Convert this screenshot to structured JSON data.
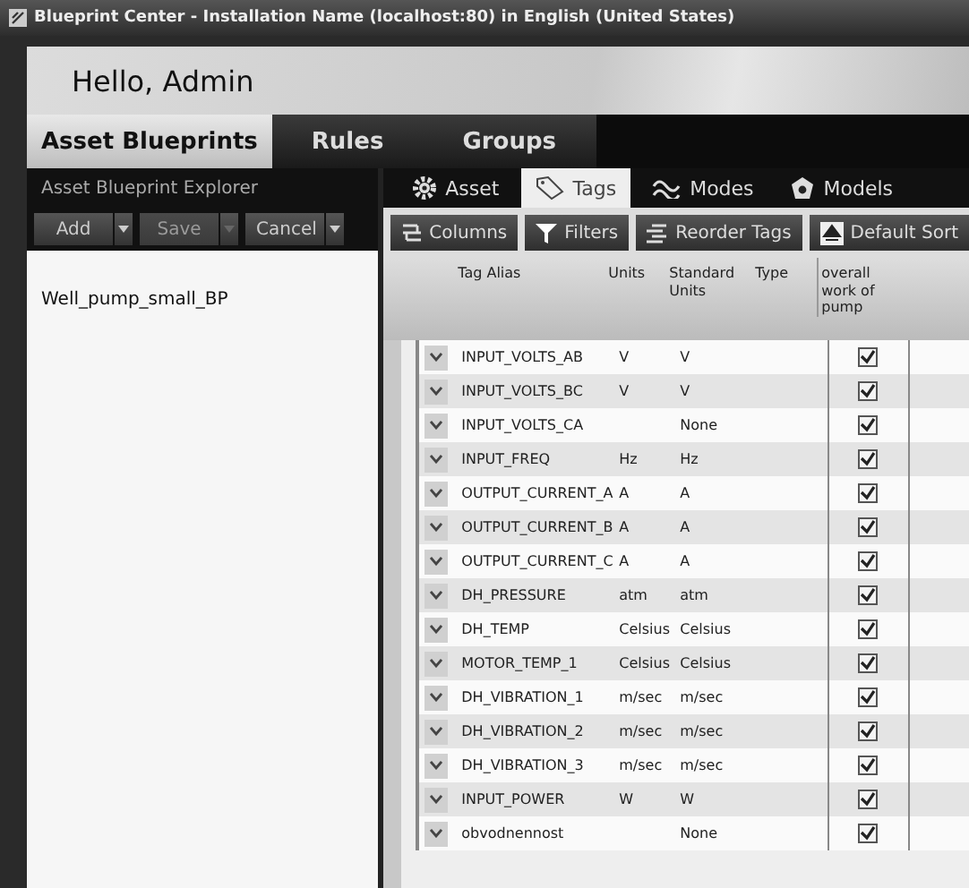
{
  "window": {
    "title": "Blueprint Center - Installation Name (localhost:80) in English (United States)"
  },
  "greeting": "Hello, Admin",
  "main_tabs": [
    {
      "label": "Asset Blueprints",
      "selected": true
    },
    {
      "label": "Rules",
      "selected": false
    },
    {
      "label": "Groups",
      "selected": false
    }
  ],
  "explorer": {
    "title": "Asset Blueprint Explorer",
    "buttons": [
      {
        "label": "Add",
        "disabled": false
      },
      {
        "label": "Save",
        "disabled": true
      },
      {
        "label": "Cancel",
        "disabled": false
      }
    ],
    "items": [
      {
        "label": "Well_pump_small_BP",
        "selected": false
      }
    ]
  },
  "detail_tabs": [
    {
      "label": "Asset",
      "selected": false
    },
    {
      "label": "Tags",
      "selected": true
    },
    {
      "label": "Modes",
      "selected": false
    },
    {
      "label": "Models",
      "selected": false
    }
  ],
  "toolbar": [
    {
      "label": "Columns"
    },
    {
      "label": "Filters"
    },
    {
      "label": "Reorder Tags"
    },
    {
      "label": "Default Sort"
    }
  ],
  "table": {
    "columns": [
      "Tag Alias",
      "Units",
      "Standard Units",
      "Type",
      "overall work of pump"
    ],
    "rows": [
      {
        "alias": "INPUT_VOLTS_AB",
        "units": "V",
        "standard_units": "V",
        "checked": true
      },
      {
        "alias": "INPUT_VOLTS_BC",
        "units": "V",
        "standard_units": "V",
        "checked": true
      },
      {
        "alias": "INPUT_VOLTS_CA",
        "standard_units": "None",
        "checked": true
      },
      {
        "alias": "INPUT_FREQ",
        "units": "Hz",
        "standard_units": "Hz",
        "checked": true
      },
      {
        "alias": "OUTPUT_CURRENT_A",
        "units": "A",
        "standard_units": "A",
        "checked": true
      },
      {
        "alias": "OUTPUT_CURRENT_B",
        "units": "A",
        "standard_units": "A",
        "checked": true
      },
      {
        "alias": "OUTPUT_CURRENT_C",
        "units": "A",
        "standard_units": "A",
        "checked": true
      },
      {
        "alias": "DH_PRESSURE",
        "units": "atm",
        "standard_units": "atm",
        "checked": true
      },
      {
        "alias": "DH_TEMP",
        "units": "Celsius",
        "standard_units": "Celsius",
        "checked": true
      },
      {
        "alias": "MOTOR_TEMP_1",
        "units": "Celsius",
        "standard_units": "Celsius",
        "checked": true
      },
      {
        "alias": "DH_VIBRATION_1",
        "units": "m/sec",
        "standard_units": "m/sec",
        "checked": true
      },
      {
        "alias": "DH_VIBRATION_2",
        "units": "m/sec",
        "standard_units": "m/sec",
        "checked": true
      },
      {
        "alias": "DH_VIBRATION_3",
        "units": "m/sec",
        "standard_units": "m/sec",
        "checked": true
      },
      {
        "alias": "INPUT_POWER",
        "units": "W",
        "standard_units": "W",
        "checked": true
      },
      {
        "alias": "obvodnennost",
        "standard_units": "None",
        "checked": true
      }
    ]
  }
}
